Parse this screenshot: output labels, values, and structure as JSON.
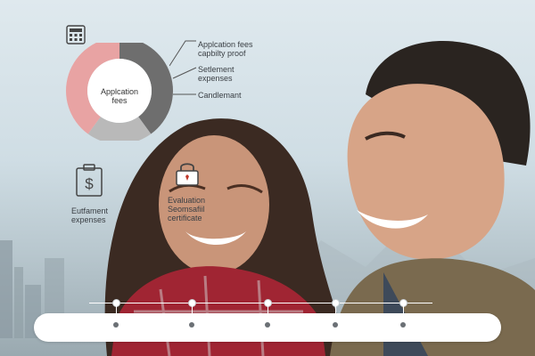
{
  "annotations": {
    "fees_label_1": "Applcation fees",
    "fees_label_2": "capbilty proof",
    "settlement_1": "Setlement",
    "settlement_2": "expenses",
    "candidate": "Candlemant",
    "pie_center": "Applcation fees",
    "entitlement_1": "Eutfament",
    "entitlement_2": "expenses",
    "evaluation_1": "Evaluation",
    "evaluation_2": "Seomsafiil",
    "evaluation_3": "certificate"
  },
  "chart_data": {
    "type": "pie",
    "donut": true,
    "slices": [
      {
        "label": "",
        "value": 40,
        "color": "#6e6e6e"
      },
      {
        "label": "",
        "value": 20,
        "color": "#b9b9b9"
      },
      {
        "label": "",
        "value": 40,
        "color": "#e8a3a3"
      }
    ],
    "center_label": "Applcation fees"
  },
  "timeline": {
    "nodes": [
      0,
      1,
      2,
      3,
      4
    ]
  },
  "colors": {
    "accent_pink": "#e8a3a3",
    "dark_gray": "#6e6e6e",
    "light_gray": "#b9b9b9"
  },
  "icons": [
    "calculator-icon",
    "receipt-dollar-icon",
    "lock-certificate-icon"
  ]
}
